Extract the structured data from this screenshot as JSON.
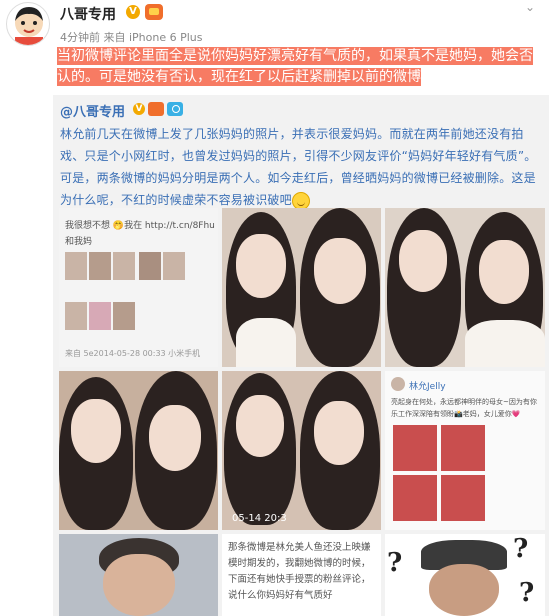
{
  "post": {
    "user_name": "八哥专用",
    "verified_badge": "V",
    "meta": "4分钟前 来自 iPhone 6 Plus",
    "highlight_text": "当初微博评论里面全是说你妈妈好漂亮好有气质的，如果真不是她妈，她会否认的。可是她没有否认，现在红了以后赶紧删掉以前的微博"
  },
  "repost": {
    "author": "@八哥专用",
    "verified_badge": "V",
    "body": "林允前几天在微博上发了几张妈妈的照片，并表示很爱妈妈。而就在两年前她还没有拍戏、只是个小网红时，也曾发过妈妈的照片，引得不少网友评价“妈妈好年轻好有气质”。可是，两条微博的妈妈分明是两个人。如今走红后，曾经晒妈妈的微博已经被删除。这是为什么呢，不红的时候虚荣不容易被识破吧"
  },
  "screenshot_top": {
    "line1": "我很想不想 🤭我在 http://t.cn/8Fhu",
    "line2": "和我妈",
    "footer": "来自 5e2014-05-28 00:33 小米手机"
  },
  "screenshot_right": {
    "name": "林允Jelly",
    "text1": "亮起身在何处，永远都神明伴的母女~因为有你",
    "text2": "乐工作深深陪有领盼📸老妈，女儿爱你💗"
  },
  "screenshot_mid": {
    "text": "那条微博是林允美人鱼还没上映嫌模时期发的，我翻她微博的时候，下面还有她快手授票的粉丝评论，说什么你妈妈好有气质好"
  },
  "timestamp": "05-14 20:3",
  "icons": [
    "more-icon",
    "verified-icon",
    "vip-icon",
    "camera-icon",
    "smile-icon"
  ],
  "colors": {
    "highlight": "#f77b63",
    "link": "#3a6fb5",
    "repost_bg": "#f2f2f2"
  }
}
